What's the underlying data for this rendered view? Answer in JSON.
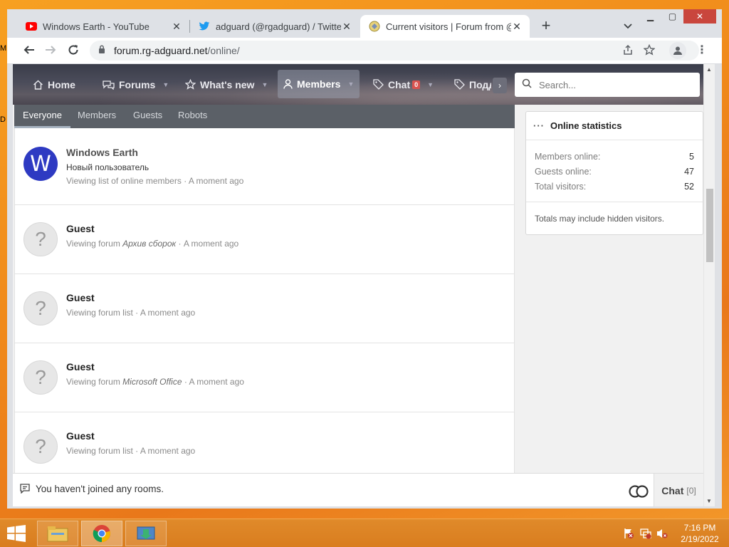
{
  "browser": {
    "tabs": [
      {
        "title": "Windows Earth - YouTube",
        "icon": "youtube-icon"
      },
      {
        "title": "adguard (@rgadguard) / Twitter",
        "icon": "twitter-icon"
      },
      {
        "title": "Current visitors | Forum from @rg",
        "icon": "forum-icon",
        "active": true
      }
    ],
    "url_host": "forum.rg-adguard.net",
    "url_path": "/online/"
  },
  "forum": {
    "nav": {
      "home": "Home",
      "forums": "Forums",
      "whats_new": "What's new",
      "members": "Members",
      "chat": "Chat",
      "chat_badge": "0",
      "more": "Подд"
    },
    "search_placeholder": "Search...",
    "subtabs": [
      "Everyone",
      "Members",
      "Guests",
      "Robots"
    ],
    "visitors": [
      {
        "name": "Windows Earth",
        "avatar_letter": "W",
        "role": "Новый пользователь",
        "activity": "Viewing list of online members",
        "forum": "",
        "time": "A moment ago"
      },
      {
        "name": "Guest",
        "avatar_letter": "?",
        "activity": "Viewing forum",
        "forum": "Архив сборок",
        "time": "A moment ago"
      },
      {
        "name": "Guest",
        "avatar_letter": "?",
        "activity": "Viewing forum list",
        "forum": "",
        "time": "A moment ago"
      },
      {
        "name": "Guest",
        "avatar_letter": "?",
        "activity": "Viewing forum",
        "forum": "Microsoft Office",
        "time": "A moment ago"
      },
      {
        "name": "Guest",
        "avatar_letter": "?",
        "activity": "Viewing forum list",
        "forum": "",
        "time": "A moment ago"
      }
    ],
    "separator": " · ",
    "stats": {
      "title": "Online statistics",
      "members_label": "Members online:",
      "members_value": "5",
      "guests_label": "Guests online:",
      "guests_value": "47",
      "total_label": "Total visitors:",
      "total_value": "52",
      "note": "Totals may include hidden visitors."
    },
    "chatbar": {
      "message": "You haven't joined any rooms.",
      "button": "Chat",
      "count": "[0]"
    }
  },
  "desktop": {
    "clock_time": "7:16 PM",
    "clock_date": "2/19/2022",
    "edge_letters": [
      "M",
      "D"
    ]
  },
  "colors": {
    "taskbar": "#d97d1f",
    "avatar_member": "#2e3ac2",
    "window_close": "#c9463d"
  }
}
